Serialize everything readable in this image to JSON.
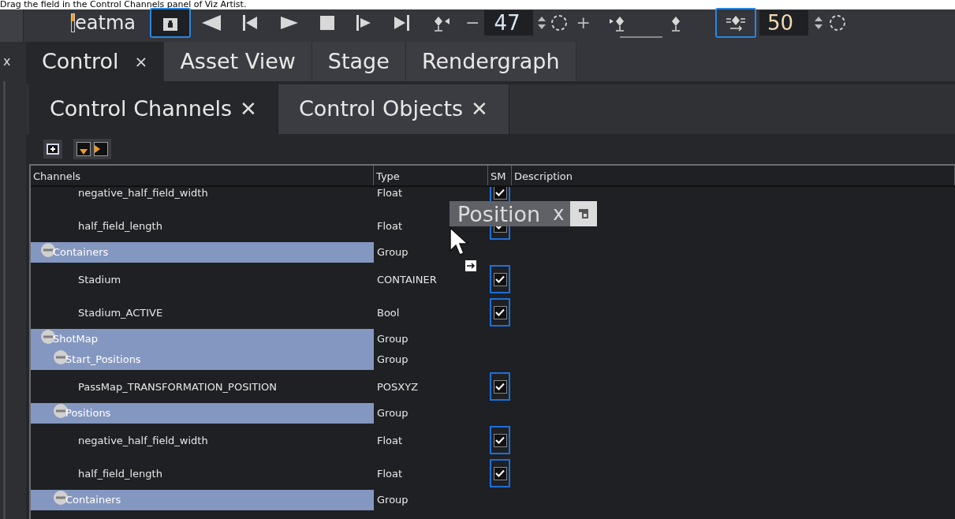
{
  "caption": "Drag the field in the Control Channels panel of Viz Artist.",
  "toolbar": {
    "search_value": "eatma",
    "lock_selected": true,
    "minus": "−",
    "frame_start": "47",
    "plus": "+",
    "filter_selected": true,
    "frame_end": "50"
  },
  "left_tab": {
    "close": "x"
  },
  "main_tabs": [
    {
      "label": "Control",
      "close": "×",
      "selected": true
    },
    {
      "label": "Asset View",
      "selected": false
    },
    {
      "label": "Stage",
      "selected": false
    },
    {
      "label": "Rendergraph",
      "selected": false
    }
  ],
  "panel_tabs": [
    {
      "label": "Control Channels",
      "close": "✕",
      "selected": true
    },
    {
      "label": "Control Objects",
      "close": "✕",
      "selected": false
    }
  ],
  "table": {
    "columns": [
      "Channels",
      "Type",
      "SM",
      "Description"
    ],
    "rows": [
      {
        "kind": "channel",
        "name": "negative_half_field_width",
        "type": "Float",
        "sm_checked": true
      },
      {
        "kind": "channel",
        "name": "half_field_length",
        "type": "Float",
        "sm_checked": true
      },
      {
        "kind": "group",
        "name": "Containers",
        "type": "Group",
        "expanded": true,
        "children": [
          {
            "kind": "channel",
            "name": "Stadium",
            "type": "CONTAINER",
            "sm_checked": true
          },
          {
            "kind": "channel",
            "name": "Stadium_ACTIVE",
            "type": "Bool",
            "sm_checked": true
          }
        ]
      },
      {
        "kind": "group",
        "name": "ShotMap",
        "type": "Group",
        "expanded": true,
        "children": [
          {
            "kind": "group",
            "name": "Start_Positions",
            "type": "Group",
            "expanded": true,
            "children": [
              {
                "kind": "channel",
                "name": "PassMap_TRANSFORMATION_POSITION",
                "type": "POSXYZ",
                "sm_checked": true
              }
            ]
          },
          {
            "kind": "group",
            "name": "Positions",
            "type": "Group",
            "expanded": true,
            "children": [
              {
                "kind": "channel",
                "name": "negative_half_field_width",
                "type": "Float",
                "sm_checked": true
              },
              {
                "kind": "channel",
                "name": "half_field_length",
                "type": "Float",
                "sm_checked": true
              }
            ]
          },
          {
            "kind": "group",
            "name": "Containers",
            "type": "Group",
            "expanded": true
          }
        ]
      }
    ]
  },
  "drag_tag": {
    "label": "Position",
    "close": "x"
  }
}
